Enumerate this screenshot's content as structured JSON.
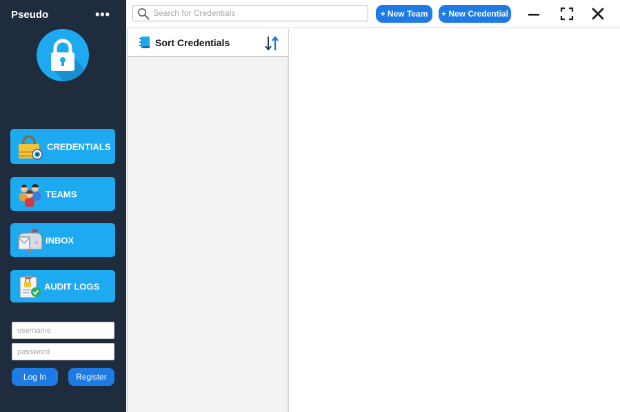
{
  "app": {
    "brand": "Pseudo",
    "menu_icon": "more-dots-icon",
    "logo_icon": "padlock-icon"
  },
  "sidebar": {
    "items": [
      {
        "label": "CREDENTIALS",
        "icon": "credentials-lock-eye-icon"
      },
      {
        "label": "TEAMS",
        "icon": "team-people-icon"
      },
      {
        "label": "INBOX",
        "icon": "mailbox-icon"
      },
      {
        "label": "AUDIT LOGS",
        "icon": "audit-clipboard-icon"
      }
    ],
    "login": {
      "username_placeholder": "username",
      "password_placeholder": "password",
      "login_label": "Log In",
      "register_label": "Register"
    }
  },
  "toolbar": {
    "search_placeholder": "Search for Credentials",
    "search_icon": "search-icon",
    "new_team_label": "+ New Team",
    "new_credential_label": "+ New Credential",
    "window_controls": [
      "minimize-icon",
      "maximize-icon",
      "close-icon"
    ]
  },
  "list": {
    "header_title": "Sort Credentials",
    "header_icon": "book-icon",
    "sort_icon": "sort-arrows-icon"
  },
  "colors": {
    "sidebar_bg": "#1f2c3d",
    "accent": "#1eaaf1",
    "button_blue": "#1e7be3",
    "list_bg": "#f3f3f3"
  }
}
